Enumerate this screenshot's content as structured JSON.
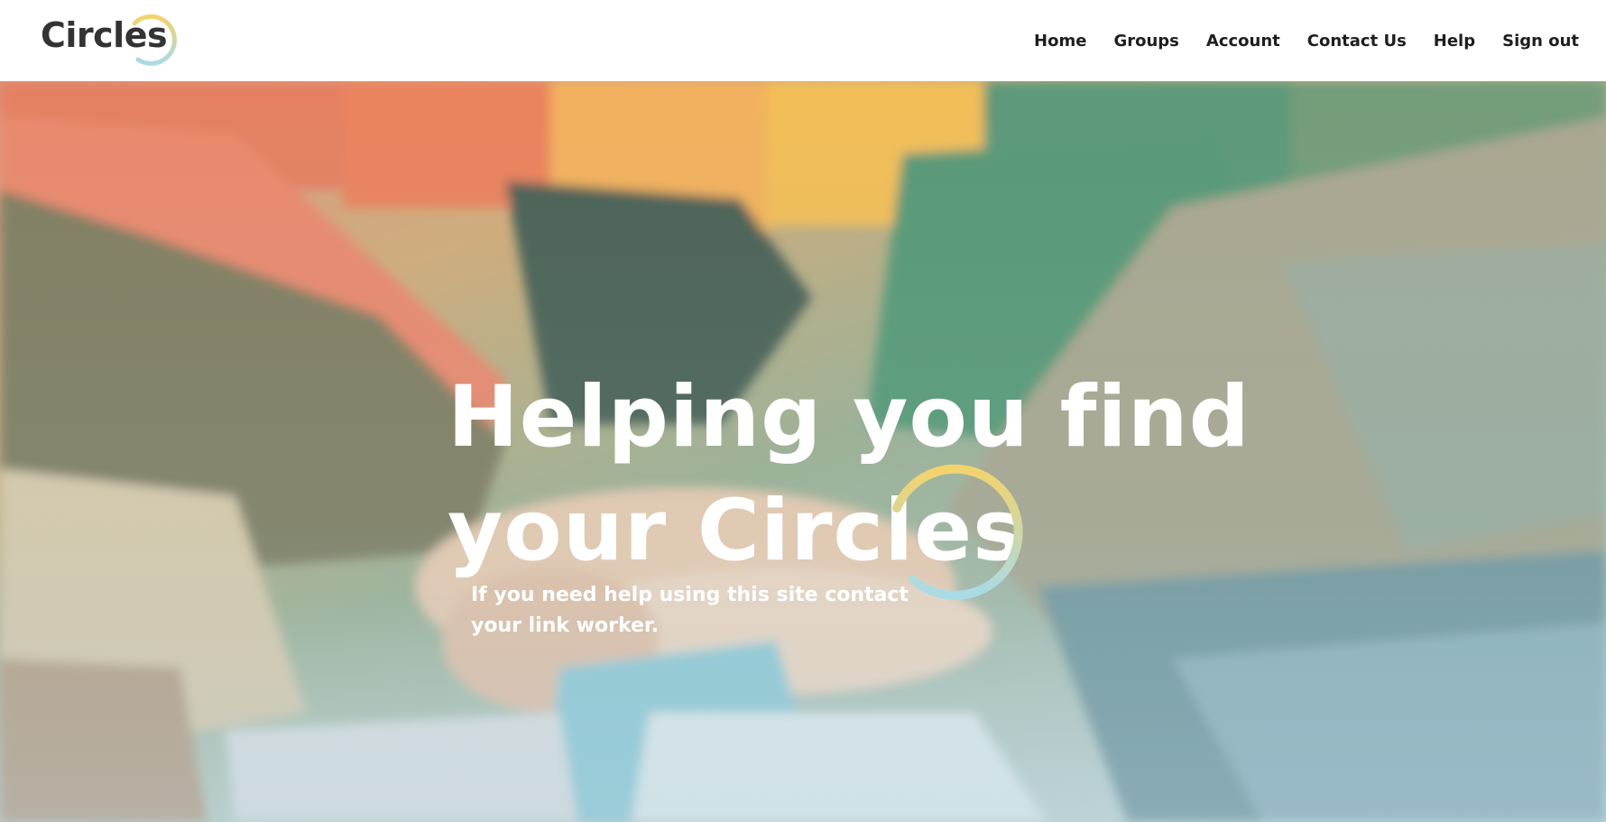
{
  "brand": {
    "name": "Circles",
    "ring_colors": [
      "#f3d36b",
      "#a9dbe6"
    ]
  },
  "nav": {
    "items": [
      {
        "label": "Home"
      },
      {
        "label": "Groups"
      },
      {
        "label": "Account"
      },
      {
        "label": "Contact Us"
      },
      {
        "label": "Help"
      },
      {
        "label": "Sign out"
      }
    ]
  },
  "hero": {
    "headline_line1": "Helping you find",
    "headline_line2": "your Circles",
    "subtext_line1": "If you need help using this site contact",
    "subtext_line2": "your link worker.",
    "text_color": "#ffffff",
    "accent_yellow": "#f3d36b",
    "accent_blue": "#a9dbe6"
  }
}
